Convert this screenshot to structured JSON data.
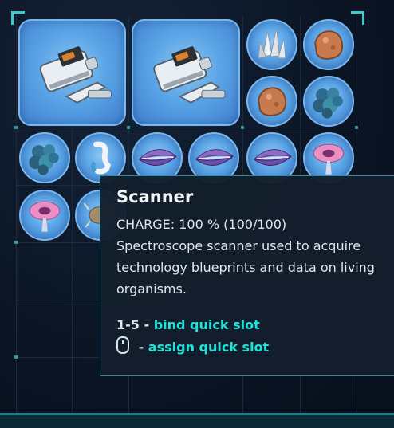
{
  "inventory": {
    "slots_row1": [
      {
        "item": "scanner",
        "icon": "scanner-icon"
      },
      {
        "item": "scanner",
        "icon": "scanner-icon"
      },
      {
        "item": "crystal",
        "icon": "crystal-icon"
      },
      {
        "item": "copper-ore",
        "icon": "copper-ore-icon"
      }
    ],
    "slots_row2": [
      {
        "item": "copper-ore",
        "icon": "copper-ore-icon"
      },
      {
        "item": "blue-coral",
        "icon": "coral-icon"
      }
    ],
    "slots_row3": [
      {
        "item": "blue-coral",
        "icon": "coral-icon"
      },
      {
        "item": "seahorse-part",
        "icon": "seahorse-icon"
      },
      {
        "item": "purple-clam",
        "icon": "clam-icon"
      },
      {
        "item": "purple-clam",
        "icon": "clam-icon"
      },
      {
        "item": "purple-clam",
        "icon": "clam-icon"
      },
      {
        "item": "pink-flower",
        "icon": "flower-icon"
      }
    ],
    "slots_row4": [
      {
        "item": "pink-flower",
        "icon": "flower-icon"
      },
      {
        "item": "fish",
        "icon": "fish-icon"
      }
    ]
  },
  "tooltip": {
    "title": "Scanner",
    "charge": "CHARGE: 100 % (100/100)",
    "description": "Spectroscope scanner used to acquire technology blueprints and data on living organisms.",
    "bind_key": "1-5",
    "bind_sep": " - ",
    "bind_action": "bind quick slot",
    "assign_sep": " - ",
    "assign_action": "assign quick slot"
  },
  "colors": {
    "accent": "#1ee3d8",
    "slot_fill": "#5aa4e6",
    "frame": "#2e8c95"
  }
}
